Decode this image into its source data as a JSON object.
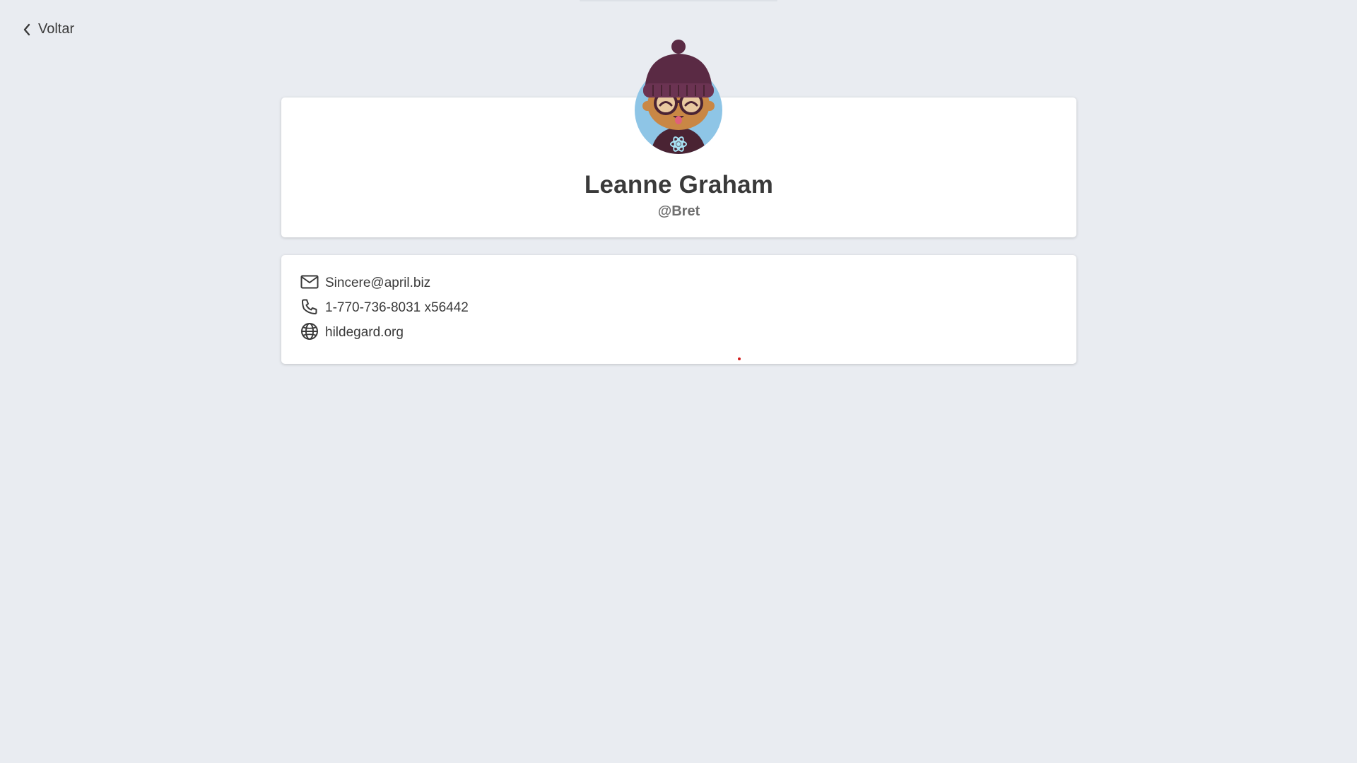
{
  "nav": {
    "back_label": "Voltar"
  },
  "profile": {
    "name": "Leanne Graham",
    "username": "@Bret",
    "avatar_icon": "avatar-illustration"
  },
  "contact": {
    "email": "Sincere@april.biz",
    "phone": "1-770-736-8031 x56442",
    "website": "hildegard.org"
  },
  "icons": {
    "back": "chevron-left-icon",
    "email": "mail-icon",
    "phone": "phone-icon",
    "website": "globe-icon"
  },
  "colors": {
    "background": "#e9ecf1",
    "card": "#ffffff",
    "text": "#3a3a3a",
    "muted": "#6e6e6e",
    "avatar_bg": "#8ec5e6",
    "beanie": "#5a2a44"
  }
}
